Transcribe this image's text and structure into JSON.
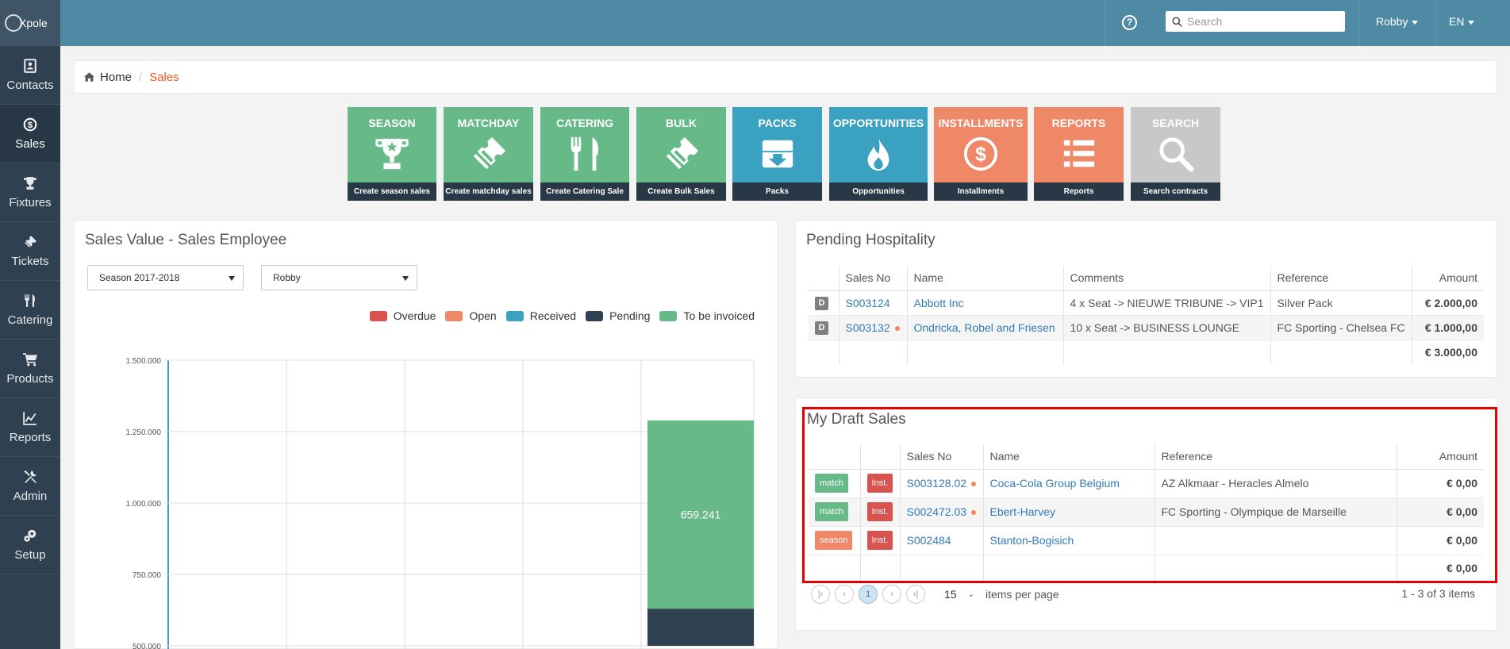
{
  "app": {
    "logo_text": "Xpole"
  },
  "sidebar": {
    "items": [
      {
        "label": "Contacts",
        "icon": "contacts-icon",
        "active": false
      },
      {
        "label": "Sales",
        "icon": "sales-icon",
        "active": true
      },
      {
        "label": "Fixtures",
        "icon": "trophy-icon",
        "active": false
      },
      {
        "label": "Tickets",
        "icon": "ticket-icon",
        "active": false
      },
      {
        "label": "Catering",
        "icon": "cutlery-icon",
        "active": false
      },
      {
        "label": "Products",
        "icon": "cart-icon",
        "active": false
      },
      {
        "label": "Reports",
        "icon": "line-chart-icon",
        "active": false
      },
      {
        "label": "Admin",
        "icon": "tools-icon",
        "active": false
      },
      {
        "label": "Setup",
        "icon": "gears-icon",
        "active": false
      }
    ]
  },
  "topbar": {
    "help_icon": "question-circle-icon",
    "search_placeholder": "Search",
    "user": "Robby",
    "language": "EN"
  },
  "breadcrumb": {
    "home": "Home",
    "current": "Sales"
  },
  "tiles": [
    {
      "title": "SEASON",
      "footer": "Create season sales",
      "color": "#67b988",
      "icon": "trophy-icon"
    },
    {
      "title": "MATCHDAY",
      "footer": "Create matchday sales",
      "color": "#67b988",
      "icon": "ticket-icon"
    },
    {
      "title": "CATERING",
      "footer": "Create Catering Sale",
      "color": "#67b988",
      "icon": "cutlery-icon"
    },
    {
      "title": "BULK",
      "footer": "Create Bulk Sales",
      "color": "#67b988",
      "icon": "ticket-icon"
    },
    {
      "title": "PACKS",
      "footer": "Packs",
      "color": "#3ba1c1",
      "icon": "archive-box-icon"
    },
    {
      "title": "OPPORTUNITIES",
      "footer": "Opportunities",
      "color": "#3ba1c1",
      "icon": "fire-icon"
    },
    {
      "title": "INSTALLMENTS",
      "footer": "Installments",
      "color": "#ef8867",
      "icon": "dollar-circle-icon"
    },
    {
      "title": "REPORTS",
      "footer": "Reports",
      "color": "#ef8867",
      "icon": "list-icon"
    },
    {
      "title": "SEARCH",
      "footer": "Search contracts",
      "color": "#c8c8c8",
      "icon": "search-icon"
    }
  ],
  "sales_chart_panel": {
    "title": "Sales Value - Sales Employee",
    "season_select": "Season 2017-2018",
    "employee_select": "Robby"
  },
  "chart_data": {
    "type": "bar",
    "title": "",
    "legend_position": "top-right",
    "grid": true,
    "y_ticks": [
      "1.500.000",
      "1.250.000",
      "1.000.000",
      "750.000",
      "500.000"
    ],
    "ylim_visible": [
      500000,
      1500000
    ],
    "series": [
      {
        "name": "Overdue",
        "color": "#d9534f"
      },
      {
        "name": "Open",
        "color": "#ef8867"
      },
      {
        "name": "Received",
        "color": "#3ba1c1"
      },
      {
        "name": "Pending",
        "color": "#2f4050"
      },
      {
        "name": "To be invoiced",
        "color": "#67b988"
      }
    ],
    "visible_bars": [
      {
        "series": "To be invoiced",
        "bottom": 630000,
        "top": 1289241,
        "value": 659241,
        "label": "659.241"
      },
      {
        "series": "Pending",
        "bottom": 500000,
        "top": 630000
      }
    ]
  },
  "pending_hospitality": {
    "title": "Pending Hospitality",
    "columns": [
      "Sales No",
      "Name",
      "Comments",
      "Reference",
      "Amount"
    ],
    "rows": [
      {
        "badge": "D",
        "sales_no": "S003124",
        "dot": false,
        "name": "Abbott Inc",
        "comments": "4 x Seat -> NIEUWE TRIBUNE -> VIP1",
        "reference": "Silver Pack",
        "amount": "€ 2.000,00"
      },
      {
        "badge": "D",
        "sales_no": "S003132",
        "dot": true,
        "name": "Ondricka, Robel and Friesen",
        "comments": "10 x Seat -> BUSINESS LOUNGE",
        "reference": "FC Sporting - Chelsea FC",
        "amount": "€ 1.000,00"
      }
    ],
    "total": "€ 3.000,00"
  },
  "draft_sales": {
    "title": "My Draft Sales",
    "columns": [
      "Sales No",
      "Name",
      "Reference",
      "Amount"
    ],
    "rows": [
      {
        "type": "match",
        "type_color": "#67b988",
        "inst": "Inst.",
        "sales_no": "S003128.02",
        "dot": true,
        "name": "Coca-Cola Group Belgium",
        "reference": "AZ Alkmaar - Heracles Almelo",
        "amount": "€ 0,00"
      },
      {
        "type": "match",
        "type_color": "#67b988",
        "inst": "Inst.",
        "sales_no": "S002472.03",
        "dot": true,
        "name": "Ebert-Harvey",
        "reference": "FC Sporting - Olympique de Marseille",
        "amount": "€ 0,00"
      },
      {
        "type": "season",
        "type_color": "#ef8867",
        "inst": "Inst.",
        "sales_no": "S002484",
        "dot": false,
        "name": "Stanton-Bogisich",
        "reference": "",
        "amount": "€ 0,00"
      }
    ],
    "total": "€ 0,00",
    "pager": {
      "current_page": "1",
      "page_size": "15",
      "items_per_page_label": "items per page",
      "summary": "1 - 3 of 3 items"
    }
  }
}
